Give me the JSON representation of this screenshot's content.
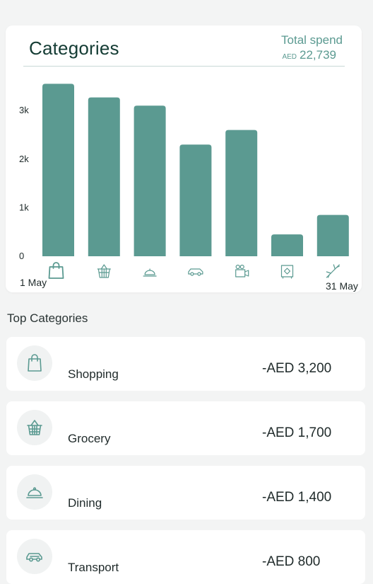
{
  "card": {
    "title": "Categories",
    "total_label": "Total spend",
    "total_currency": "AED",
    "total_value": "22,739",
    "date_start": "1 May",
    "date_end": "31 May"
  },
  "colors": {
    "bar": "#5b9a91",
    "accent": "#5b9a91",
    "dark": "#143c34"
  },
  "chart_data": {
    "type": "bar",
    "categories": [
      "shopping",
      "grocery",
      "dining",
      "transport",
      "entertainment",
      "utilities",
      "travel"
    ],
    "category_icons": [
      "bag-icon",
      "basket-icon",
      "cloche-icon",
      "car-icon",
      "camera-icon",
      "safe-icon",
      "plane-icon"
    ],
    "values": [
      3550,
      3270,
      3100,
      2300,
      2600,
      450,
      850
    ],
    "yticks": [
      "0",
      "1k",
      "2k",
      "3k"
    ],
    "ylim": [
      0,
      3600
    ],
    "grid": false
  },
  "top_categories": {
    "title": "Top Categories",
    "items": [
      {
        "name": "Shopping",
        "amount": "-AED 3,200",
        "icon": "bag-icon"
      },
      {
        "name": "Grocery",
        "amount": "-AED 1,700",
        "icon": "basket-icon"
      },
      {
        "name": "Dining",
        "amount": "-AED 1,400",
        "icon": "cloche-icon"
      },
      {
        "name": "Transport",
        "amount": "-AED 800",
        "icon": "car-icon"
      }
    ]
  }
}
